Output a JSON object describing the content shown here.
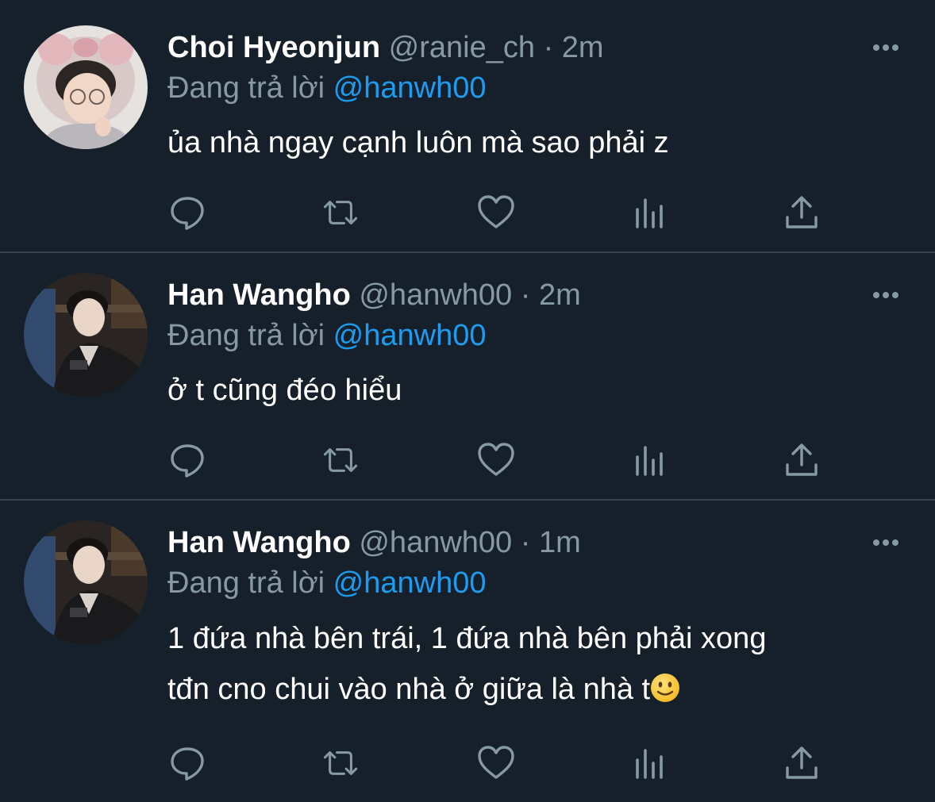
{
  "colors": {
    "background": "#15202b",
    "divider": "#38444d",
    "secondary_text": "#8899a6",
    "mention": "#1d9bf0",
    "primary_text": "#ffffff"
  },
  "icons": [
    "more-icon",
    "reply-icon",
    "retweet-icon",
    "like-icon",
    "analytics-icon",
    "share-icon",
    "slightly-smiling-face-emoji"
  ],
  "tweets": [
    {
      "display_name": "Choi Hyeonjun",
      "handle": "@ranie_ch",
      "separator": "·",
      "time": "2m",
      "reply_prefix": "Đang trả lời",
      "reply_to": "@hanwh00",
      "text_lines": [
        "ủa nhà ngay cạnh luôn mà sao phải z"
      ]
    },
    {
      "display_name": "Han Wangho",
      "handle": "@hanwh00",
      "separator": "·",
      "time": "2m",
      "reply_prefix": "Đang trả lời",
      "reply_to": "@hanwh00",
      "text_lines": [
        "ở t cũng đéo hiểu"
      ]
    },
    {
      "display_name": "Han Wangho",
      "handle": "@hanwh00",
      "separator": "·",
      "time": "1m",
      "reply_prefix": "Đang trả lời",
      "reply_to": "@hanwh00",
      "text_lines": [
        "1 đứa nhà bên trái, 1 đứa nhà bên phải xong",
        "tđn cno chui vào nhà ở giữa là nhà t"
      ]
    }
  ]
}
